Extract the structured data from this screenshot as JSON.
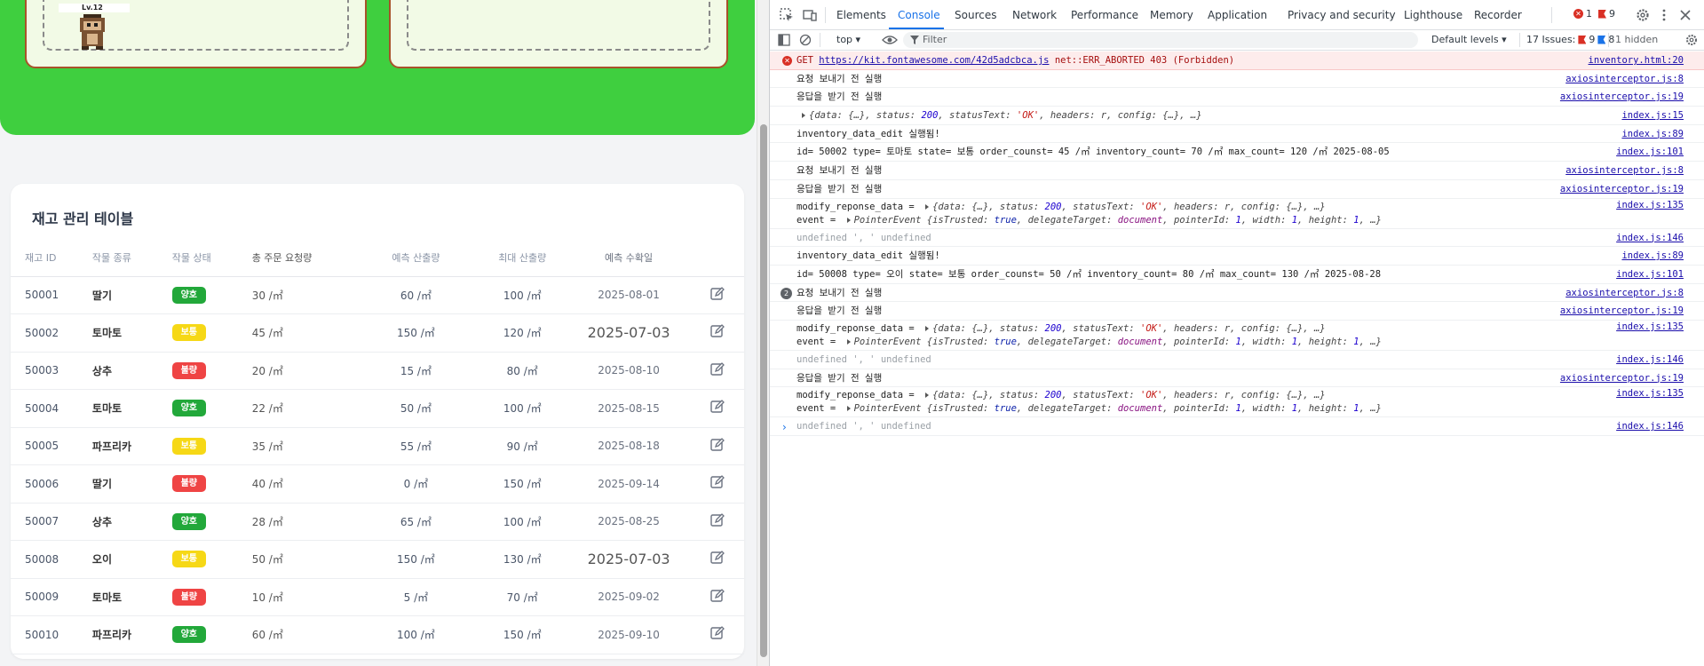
{
  "game": {
    "level_label": "Lv.12"
  },
  "table": {
    "title": "재고 관리 테이블",
    "headers": [
      "재고 ID",
      "작물 종류",
      "작물 상태",
      "총 주문 요청량",
      "예측 산출량",
      "최대 산출량",
      "예측 수확일"
    ],
    "rows": [
      {
        "id": "50001",
        "type": "딸기",
        "state": "양호",
        "order": "30 /㎡",
        "pred": "60 /㎡",
        "max": "100 /㎡",
        "date": "2025-08-01"
      },
      {
        "id": "50002",
        "type": "토마토",
        "state": "보통",
        "order": "45 /㎡",
        "pred": "150 /㎡",
        "max": "120 /㎡",
        "date": "2025-07-03"
      },
      {
        "id": "50003",
        "type": "상추",
        "state": "불량",
        "order": "20 /㎡",
        "pred": "15 /㎡",
        "max": "80 /㎡",
        "date": "2025-08-10"
      },
      {
        "id": "50004",
        "type": "토마토",
        "state": "양호",
        "order": "22 /㎡",
        "pred": "50 /㎡",
        "max": "100 /㎡",
        "date": "2025-08-15"
      },
      {
        "id": "50005",
        "type": "파프리카",
        "state": "보통",
        "order": "35 /㎡",
        "pred": "55 /㎡",
        "max": "90 /㎡",
        "date": "2025-08-18"
      },
      {
        "id": "50006",
        "type": "딸기",
        "state": "불량",
        "order": "40 /㎡",
        "pred": "0 /㎡",
        "max": "150 /㎡",
        "date": "2025-09-14"
      },
      {
        "id": "50007",
        "type": "상추",
        "state": "양호",
        "order": "28 /㎡",
        "pred": "65 /㎡",
        "max": "100 /㎡",
        "date": "2025-08-25"
      },
      {
        "id": "50008",
        "type": "오이",
        "state": "보통",
        "order": "50 /㎡",
        "pred": "150 /㎡",
        "max": "130 /㎡",
        "date": "2025-07-03"
      },
      {
        "id": "50009",
        "type": "토마토",
        "state": "불량",
        "order": "10 /㎡",
        "pred": "5 /㎡",
        "max": "70 /㎡",
        "date": "2025-09-02"
      },
      {
        "id": "50010",
        "type": "파프리카",
        "state": "양호",
        "order": "60 /㎡",
        "pred": "100 /㎡",
        "max": "150 /㎡",
        "date": "2025-09-10"
      }
    ]
  },
  "devtools": {
    "tabs": [
      "Elements",
      "Console",
      "Sources",
      "Network",
      "Performance",
      "Memory",
      "Application",
      "Privacy and security",
      "Lighthouse",
      "Recorder"
    ],
    "active_tab": "Console",
    "errors_count": "1",
    "warnings_count": "9",
    "context": "top",
    "filter_placeholder": "Filter",
    "levels": "Default levels",
    "issues_label": "17 Issues:",
    "issues_warn": "9",
    "issues_info": "8",
    "hidden": "1 hidden",
    "err": {
      "get": "GET",
      "url": "https://kit.fontawesome.com/42d5adcbca.js",
      "msg": "net::ERR_ABORTED 403 (Forbidden)",
      "src": "inventory.html:20"
    },
    "msgs": {
      "req_before": "요청 보내기 전 실행",
      "res_before": "응답을 받기 전 실행",
      "edit_run": "inventory_data_edit 실행됨!",
      "id1": "id= 50002   type= 토마토  state= 보통  order_counst= 45 /㎡  inventory_count= 70 /㎡  max_count= 120 /㎡ 2025-08-05",
      "id2": "id= 50008   type= 오이  state= 보통  order_counst= 50 /㎡  inventory_count= 80 /㎡  max_count= 130 /㎡ 2025-08-28",
      "modify": "modify_reponse_data = ",
      "event": "event = ",
      "undef": "undefined ', ' undefined",
      "repeat": "2",
      "obj_resp_a": "{data: {…}, status: ",
      "obj_status": "200",
      "obj_resp_b": ", statusText: ",
      "obj_ok": "'OK'",
      "obj_resp_c": ", headers: r, config: {…}, …}",
      "pe_name": "PointerEvent ",
      "pe_a": "{isTrusted: ",
      "pe_true": "true",
      "pe_b": ", delegateTarget: ",
      "pe_doc": "document",
      "pe_c": ", pointerId: ",
      "pe_one": "1",
      "pe_d": ", width: ",
      "pe_e": ", height: ",
      "pe_f": ", …}"
    },
    "src": {
      "ax8": "axiosinterceptor.js:8",
      "ax19": "axiosinterceptor.js:19",
      "i15": "index.js:15",
      "i89": "index.js:89",
      "i101": "index.js:101",
      "i135": "index.js:135",
      "i146": "index.js:146"
    },
    "prompt": "›"
  }
}
